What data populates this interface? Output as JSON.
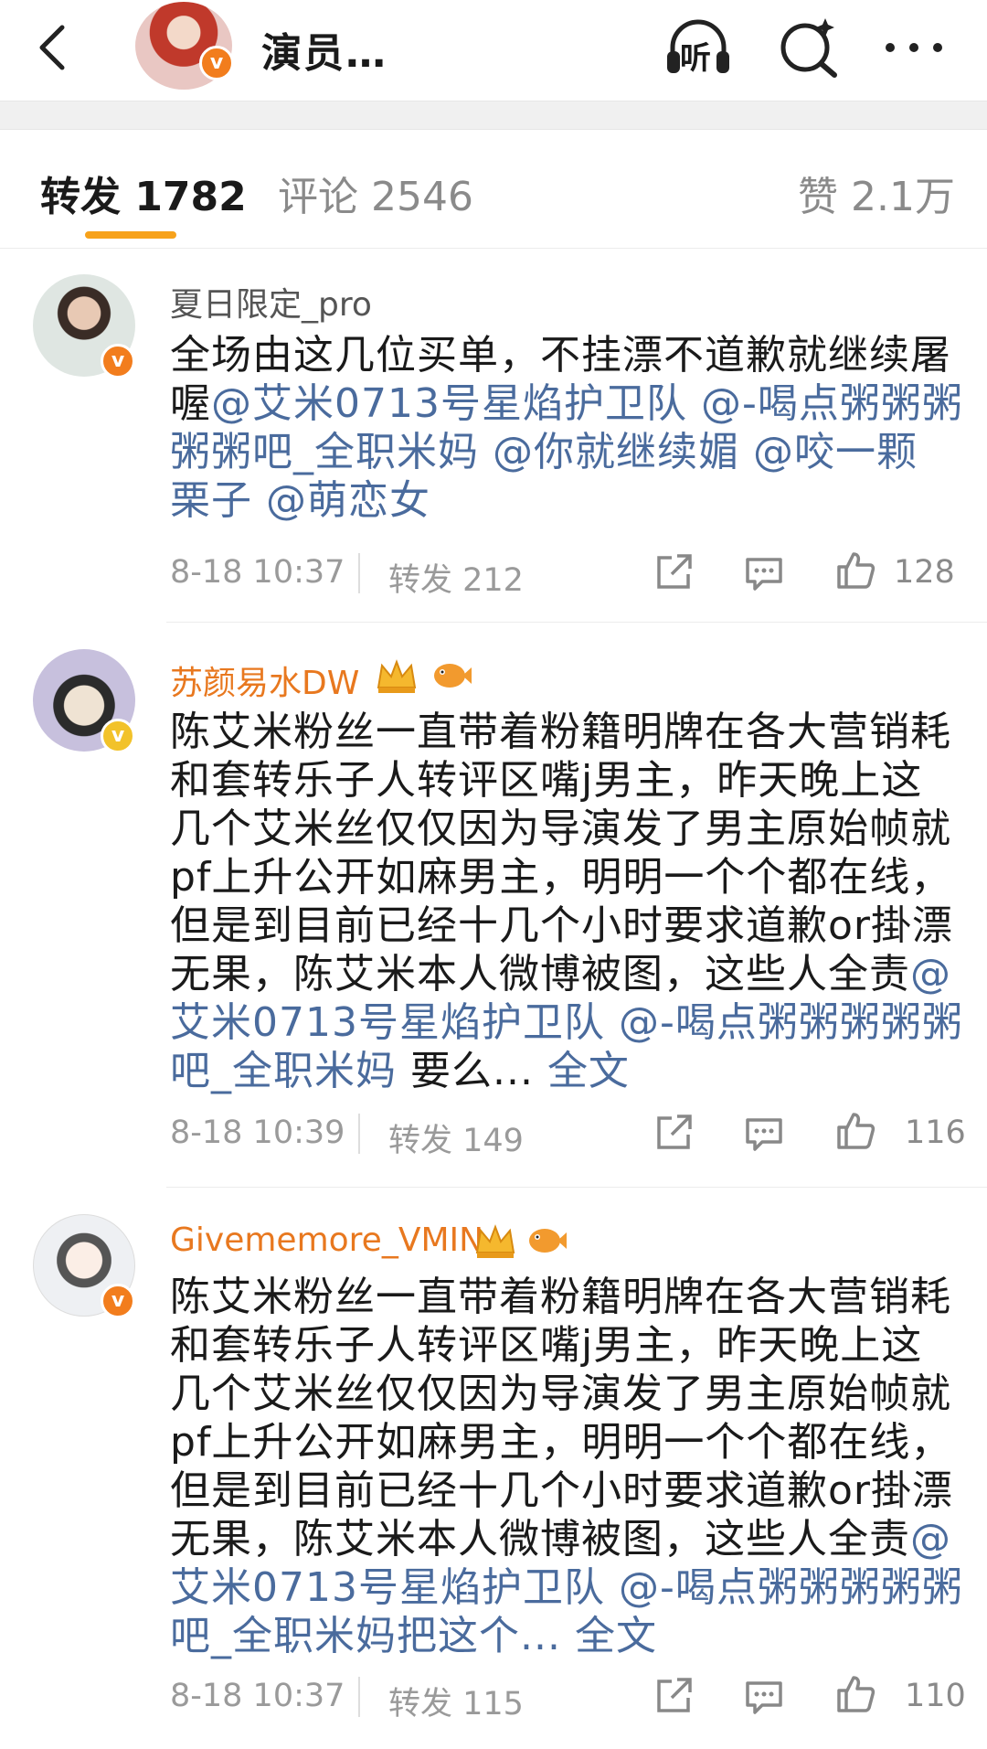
{
  "header": {
    "title": "演员…",
    "listen_label": "听"
  },
  "tabs": [
    {
      "label": "转发 1782"
    },
    {
      "label": "评论 2546"
    },
    {
      "label": "赞 2.1万"
    }
  ],
  "colors": {
    "accent": "#f7a21b",
    "mention": "#4a6b9d",
    "vip_name": "#e8781f",
    "verified": "#f27d1d"
  },
  "comments": [
    {
      "username": "夏日限定_pro",
      "text_lines": [
        [
          {
            "t": "全场由这几位买单，不挂漂不道歉就继续屠",
            "m": false
          }
        ],
        [
          {
            "t": "喔",
            "m": false
          },
          {
            "t": "@艾米0713号星焰护卫队 @-喝点粥粥粥",
            "m": true
          }
        ],
        [
          {
            "t": "粥粥吧_全职米妈 @你就继续媚 @咬一颗",
            "m": true
          }
        ],
        [
          {
            "t": "栗子 @萌恋女",
            "m": true
          }
        ]
      ],
      "time": "8-18 10:37",
      "repost": "转发 212",
      "likes": "128"
    },
    {
      "username": "苏颜易水DW",
      "text_lines": [
        [
          {
            "t": "陈艾米粉丝一直带着粉籍明牌在各大营销耗",
            "m": false
          }
        ],
        [
          {
            "t": "和套转乐子人转评区嘴j男主，昨天晚上这",
            "m": false
          }
        ],
        [
          {
            "t": "几个艾米丝仅仅因为导演发了男主原始帧就",
            "m": false
          }
        ],
        [
          {
            "t": "pf上升公开如麻男主，明明一个个都在线，",
            "m": false
          }
        ],
        [
          {
            "t": "但是到目前已经十几个小时要求道歉or掛漂",
            "m": false
          }
        ],
        [
          {
            "t": "无果，陈艾米本人微博被图，这些人全责",
            "m": false
          },
          {
            "t": "@",
            "m": true
          }
        ],
        [
          {
            "t": "艾米0713号星焰护卫队 @-喝点粥粥粥粥粥",
            "m": true
          }
        ],
        [
          {
            "t": "吧_全职米妈",
            "m": true
          },
          {
            "t": " 要么... ",
            "m": false
          },
          {
            "t": "全文",
            "m": true
          }
        ]
      ],
      "time": "8-18 10:39",
      "repost": "转发 149",
      "likes": "116"
    },
    {
      "username": "Givememore_VMIN",
      "text_lines": [
        [
          {
            "t": "陈艾米粉丝一直带着粉籍明牌在各大营销耗",
            "m": false
          }
        ],
        [
          {
            "t": "和套转乐子人转评区嘴j男主，昨天晚上这",
            "m": false
          }
        ],
        [
          {
            "t": "几个艾米丝仅仅因为导演发了男主原始帧就",
            "m": false
          }
        ],
        [
          {
            "t": "pf上升公开如麻男主，明明一个个都在线，",
            "m": false
          }
        ],
        [
          {
            "t": "但是到目前已经十几个小时要求道歉or掛漂",
            "m": false
          }
        ],
        [
          {
            "t": "无果，陈艾米本人微博被图，这些人全责",
            "m": false
          },
          {
            "t": "@",
            "m": true
          }
        ],
        [
          {
            "t": "艾米0713号星焰护卫队 @-喝点粥粥粥粥粥",
            "m": true
          }
        ],
        [
          {
            "t": "吧_全职米妈把这个... ",
            "m": true
          },
          {
            "t": "全文",
            "m": true
          }
        ]
      ],
      "time": "8-18 10:37",
      "repost": "转发 115",
      "likes": "110"
    }
  ]
}
